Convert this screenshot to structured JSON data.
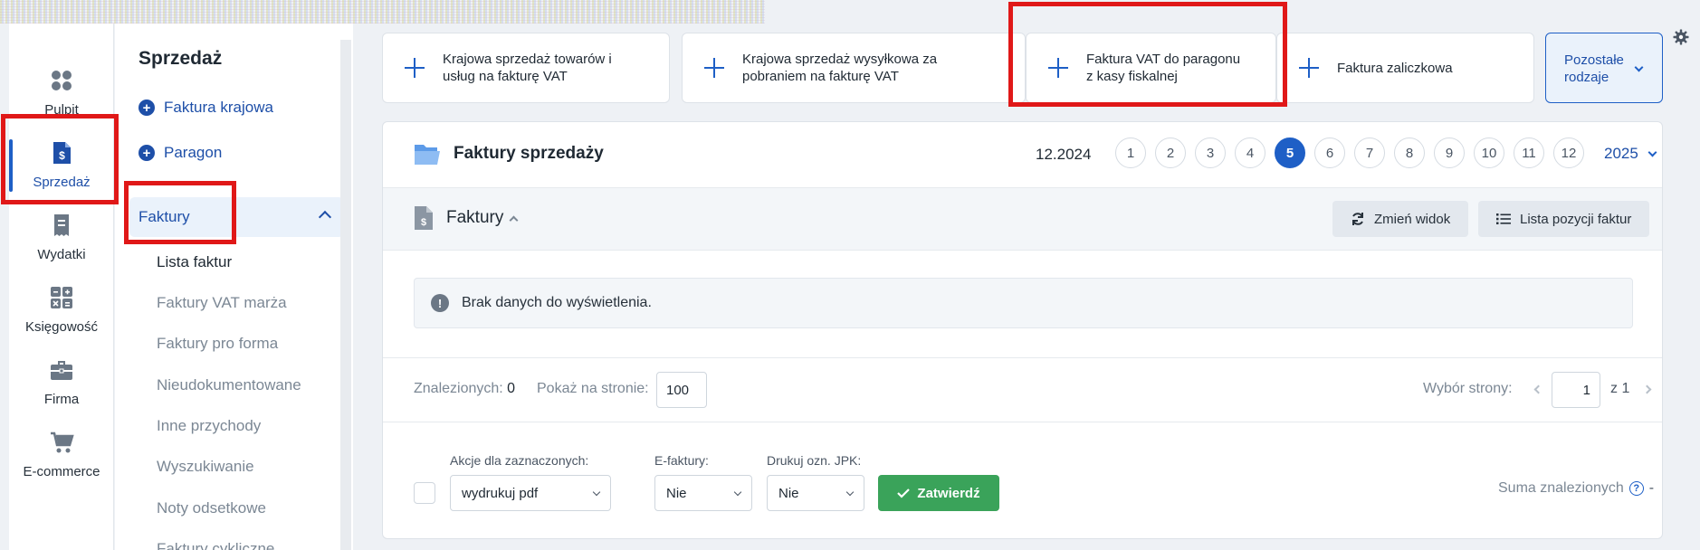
{
  "rail": {
    "items": [
      {
        "label": "Pulpit",
        "icon": "dashboard-icon"
      },
      {
        "label": "Sprzedaż",
        "icon": "invoice-dollar-icon"
      },
      {
        "label": "Wydatki",
        "icon": "receipt-icon"
      },
      {
        "label": "Księgowość",
        "icon": "calculator-icon"
      },
      {
        "label": "Firma",
        "icon": "briefcase-icon"
      },
      {
        "label": "E-commerce",
        "icon": "cart-icon"
      }
    ],
    "active": "Sprzedaż"
  },
  "submenu": {
    "title": "Sprzedaż",
    "actions": [
      {
        "label": "Faktura krajowa",
        "icon": "plus-circle-icon"
      },
      {
        "label": "Paragon",
        "icon": "plus-circle-icon"
      }
    ],
    "group_label": "Faktury",
    "links": [
      "Lista faktur",
      "Faktury VAT marża",
      "Faktury pro forma",
      "Nieudokumentowane",
      "Inne przychody",
      "Wyszukiwanie",
      "Noty odsetkowe",
      "Faktury cykliczne"
    ]
  },
  "quick_actions": [
    {
      "l1": "Krajowa sprzedaż towarów i",
      "l2": "usług na fakturę VAT"
    },
    {
      "l1": "Krajowa sprzedaż wysyłkowa za",
      "l2": "pobraniem na fakturę VAT"
    },
    {
      "l1": "Faktura VAT do paragonu",
      "l2": "z kasy fiskalnej"
    },
    {
      "l1": "Faktura zaliczkowa",
      "l2": ""
    }
  ],
  "more_types": {
    "l1": "Pozostałe",
    "l2": "rodzaje"
  },
  "main": {
    "title": "Faktury sprzedaży",
    "period": "12.2024",
    "months": [
      "1",
      "2",
      "3",
      "4",
      "5",
      "6",
      "7",
      "8",
      "9",
      "10",
      "11",
      "12"
    ],
    "active_month": "5",
    "year": "2025",
    "section_title": "Faktury",
    "change_view": "Zmień widok",
    "items_list": "Lista pozycji faktur",
    "empty_message": "Brak danych do wyświetlenia.",
    "found_label": "Znalezionych:",
    "found_count": "0",
    "per_page_label": "Pokaż na stronie:",
    "per_page_value": "100",
    "page_select_label": "Wybór strony:",
    "page_value": "1",
    "page_of": "z",
    "page_total": "1",
    "bulk_label": "Akcje dla zaznaczonych:",
    "bulk_value": "wydrukuj pdf",
    "einvoice_label": "E-faktury:",
    "einvoice_value": "Nie",
    "jpk_label": "Drukuj ozn. JPK:",
    "jpk_value": "Nie",
    "confirm": "Zatwierdź",
    "sum_label": "Suma znalezionych",
    "sum_value": "-"
  },
  "colors": {
    "accent": "#1e5fc6",
    "confirm": "#3aa35a",
    "highlight": "#e01818"
  }
}
